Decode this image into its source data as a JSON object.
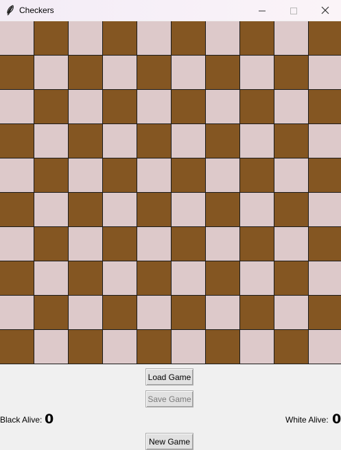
{
  "window": {
    "title": "Checkers",
    "icon": "feather-icon",
    "controls": [
      "minimize-icon",
      "maximize-icon",
      "close-icon"
    ]
  },
  "board": {
    "rows": 10,
    "cols": 10,
    "light_color": "#ddc9ca",
    "dark_color": "#845622",
    "top_left": "light"
  },
  "buttons": {
    "load_label": "Load Game",
    "save_label": "Save Game",
    "new_label": "New Game"
  },
  "status": {
    "black_label": "Black Alive:",
    "black_count": "0",
    "white_label": "White Alive:",
    "white_count": "0"
  }
}
